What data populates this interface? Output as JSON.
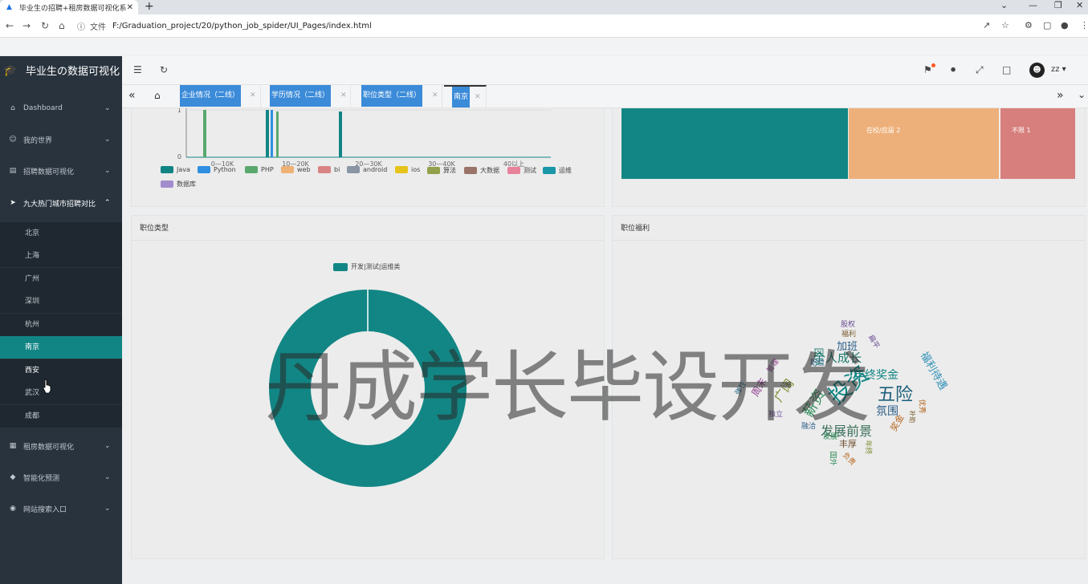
{
  "browser": {
    "tab_title": "毕业生の招聘+租房数据可视化系",
    "file_label": "文件",
    "url": "F:/Graduation_project/20/python_job_spider/UI_Pages/index.html"
  },
  "app": {
    "brand": "毕业生の数据可视化",
    "user": "zz"
  },
  "sidebar": {
    "items": [
      {
        "label": "Dashboard",
        "icon": "home-icon"
      },
      {
        "label": "我的世界",
        "icon": "smile-icon"
      },
      {
        "label": "招聘数据可视化",
        "icon": "chart-icon"
      },
      {
        "label": "九大热门城市招聘对比",
        "icon": "send-icon"
      },
      {
        "label": "租房数据可视化",
        "icon": "building-icon"
      },
      {
        "label": "智能化预测",
        "icon": "diamond-icon"
      },
      {
        "label": "网站搜索入口",
        "icon": "globe-icon"
      }
    ],
    "cities": [
      "北京",
      "上海",
      "广州",
      "深圳",
      "杭州",
      "南京",
      "西安",
      "武汉",
      "成都"
    ]
  },
  "page_tabs": [
    "企业情况（二线）",
    "学历情况（二线）",
    "职位类型（二线）",
    "南京"
  ],
  "top_left_chart": {
    "x_ticks": [
      "0—10K",
      "10—20K",
      "20—30K",
      "30—40K",
      "40以上"
    ],
    "y_ticks": [
      "1",
      "0"
    ],
    "legend": [
      {
        "name": "Java",
        "color": "#118584"
      },
      {
        "name": "Python",
        "color": "#2f8fe0"
      },
      {
        "name": "PHP",
        "color": "#5aa86e"
      },
      {
        "name": "web",
        "color": "#eeb275"
      },
      {
        "name": "bi",
        "color": "#d98484"
      },
      {
        "name": "android",
        "color": "#8a95a5"
      },
      {
        "name": "ios",
        "color": "#e5c31a"
      },
      {
        "name": "算法",
        "color": "#93a14d"
      },
      {
        "name": "大数据",
        "color": "#9a7468"
      },
      {
        "name": "测试",
        "color": "#e8829b"
      },
      {
        "name": "运维",
        "color": "#1897a8"
      },
      {
        "name": "数据库",
        "color": "#a38ccd"
      }
    ]
  },
  "treemap": {
    "cells": [
      {
        "label": "",
        "value": 6,
        "color": "#128684"
      },
      {
        "label": "在校/应届 2",
        "value": 2,
        "color": "#eeb07a"
      },
      {
        "label": "不限 1",
        "value": 1,
        "color": "#d77f7d"
      }
    ]
  },
  "job_type": {
    "title": "职位类型",
    "legend": "开发|测试|运维类",
    "color": "#128684"
  },
  "job_welfare": {
    "title": "职位福利",
    "words": [
      {
        "t": "股权",
        "c": "#6a4c93"
      },
      {
        "t": "福利",
        "c": "#7a5c2e"
      },
      {
        "t": "加班",
        "c": "#2d5f8a"
      },
      {
        "t": "个人成长",
        "c": "#1b7a6e"
      },
      {
        "t": "年终奖金",
        "c": "#118584"
      },
      {
        "t": "福利待遇",
        "c": "#2f8fb8"
      },
      {
        "t": "五险",
        "c": "#1c5f7a"
      },
      {
        "t": "投资",
        "c": "#118584"
      },
      {
        "t": "薪资",
        "c": "#2e8b57"
      },
      {
        "t": "广阔",
        "c": "#7a8b2e"
      },
      {
        "t": "周末",
        "c": "#8e3b8e"
      },
      {
        "t": "氛围",
        "c": "#2d5f8a"
      },
      {
        "t": "发展前景",
        "c": "#3a6f5a"
      },
      {
        "t": "丰厚",
        "c": "#6f4f2f"
      },
      {
        "t": "融洽",
        "c": "#2d5f8a"
      },
      {
        "t": "独立",
        "c": "#6a4c93"
      },
      {
        "t": "奖金",
        "c": "#b5651d"
      },
      {
        "t": "补助",
        "c": "#7a5c2e"
      },
      {
        "t": "团队",
        "c": "#1b7a6e"
      },
      {
        "t": "国外",
        "c": "#2e8b57"
      },
      {
        "t": "负责",
        "c": "#b5651d"
      },
      {
        "t": "年终",
        "c": "#7a8b2e"
      },
      {
        "t": "发展",
        "c": "#2e8b57"
      },
      {
        "t": "扁平",
        "c": "#6a4c93"
      },
      {
        "t": "管理",
        "c": "#8e3b8e"
      },
      {
        "t": "弹性",
        "c": "#1c5f7a"
      },
      {
        "t": "优秀",
        "c": "#b5651d"
      },
      {
        "t": "职位",
        "c": "#2d5f8a"
      }
    ]
  },
  "watermark": "丹成学长毕设开发"
}
